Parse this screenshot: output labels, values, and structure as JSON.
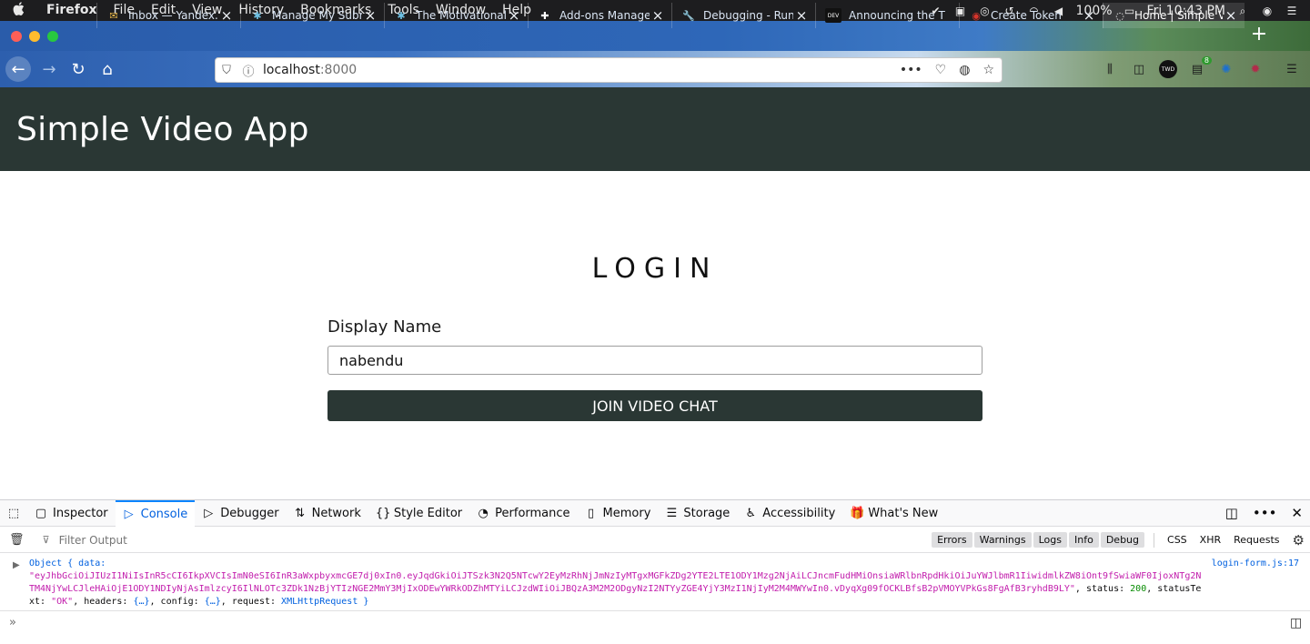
{
  "menubar": {
    "apple": "",
    "app_name": "Firefox",
    "menus": [
      "File",
      "Edit",
      "View",
      "History",
      "Bookmarks",
      "Tools",
      "Window",
      "Help"
    ],
    "battery": "100%",
    "clock": "Fri 10:43 PM"
  },
  "tabs": [
    {
      "label": "Inbox — Yandex.M",
      "favicon": "✉",
      "favicon_color": "#e9b84a"
    },
    {
      "label": "Manage My Submi",
      "favicon": "✱",
      "favicon_color": "#6ec1e4"
    },
    {
      "label": "The Motivational T",
      "favicon": "✱",
      "favicon_color": "#6ec1e4"
    },
    {
      "label": "Add-ons Manager",
      "favicon": "✚",
      "favicon_color": "#ffffff"
    },
    {
      "label": "Debugging - Runti",
      "favicon": "🔧",
      "favicon_color": "#ffffff"
    },
    {
      "label": "Announcing the T",
      "favicon": "DEV",
      "favicon_color": "#111111"
    },
    {
      "label": "Create Token",
      "favicon": "◉",
      "favicon_color": "#d9342b"
    },
    {
      "label": "Home | Simple Vi",
      "favicon": "◌",
      "favicon_color": "#ffffff"
    }
  ],
  "navbar": {
    "url_host": "localhost",
    "url_port": ":8000",
    "ext_badge": "8",
    "ext_label": "TWD"
  },
  "app": {
    "title": "Simple Video App",
    "login_heading": "LOGIN",
    "name_label": "Display Name",
    "name_value": "nabendu",
    "join_label": "JOIN VIDEO CHAT",
    "header_color": "#2a3734"
  },
  "devtools": {
    "tabs": [
      {
        "label": "Inspector",
        "icon": "▢"
      },
      {
        "label": "Console",
        "icon": "▷"
      },
      {
        "label": "Debugger",
        "icon": "▷"
      },
      {
        "label": "Network",
        "icon": "⇅"
      },
      {
        "label": "Style Editor",
        "icon": "{}"
      },
      {
        "label": "Performance",
        "icon": "◔"
      },
      {
        "label": "Memory",
        "icon": "▯"
      },
      {
        "label": "Storage",
        "icon": "☰"
      },
      {
        "label": "Accessibility",
        "icon": "♿"
      },
      {
        "label": "What's New",
        "icon": "🎁"
      }
    ],
    "filter_placeholder": "Filter Output",
    "levels": [
      "Errors",
      "Warnings",
      "Logs",
      "Info",
      "Debug"
    ],
    "net_filters": [
      "CSS",
      "XHR",
      "Requests"
    ],
    "log": {
      "prefix": "Object { data:",
      "token": "\"eyJhbGciOiJIUzI1NiIsInR5cCI6IkpXVCIsImN0eSI6InR3aWxpbyxmcGE7dj0xIn0.eyJqdGkiOiJTSzk3N2Q5NTcwY2EyMzRhNjJmNzIyMTgxMGFkZDg2YTE2LTE1ODY1Mzg2NjAiLCJncmFudHMiOnsiaWRlbnRpdHkiOiJuYWJlbmR1IiwidmlkZW8iOnt9fSwiaWF0IjoxNTg2NTM4NjYwLCJleHAiOjE1ODY1NDIyNjAsImlzcyI6IlNLOTc3ZDk1NzBjYTIzNGE2MmY3MjIxODEwYWRkODZhMTYiLCJzdWIiOiJBQzA3M2M2ODgyNzI2NTYyZGE4YjY3MzI1NjIyM2M4MWYwIn0.vDyqXg09fOCKLBfsB2pVMOYVPkGs8FgAfB3ryhdB9LY\"",
      "status_key": "status:",
      "status_val": "200",
      "status_text_key": "statusText:",
      "status_text_val": "\"OK\"",
      "headers_key": "headers:",
      "config_key": "config:",
      "request_key": "request:",
      "collapsed": "{…}",
      "request_val": "XMLHttpRequest }",
      "source": "login-form.js:17"
    }
  }
}
